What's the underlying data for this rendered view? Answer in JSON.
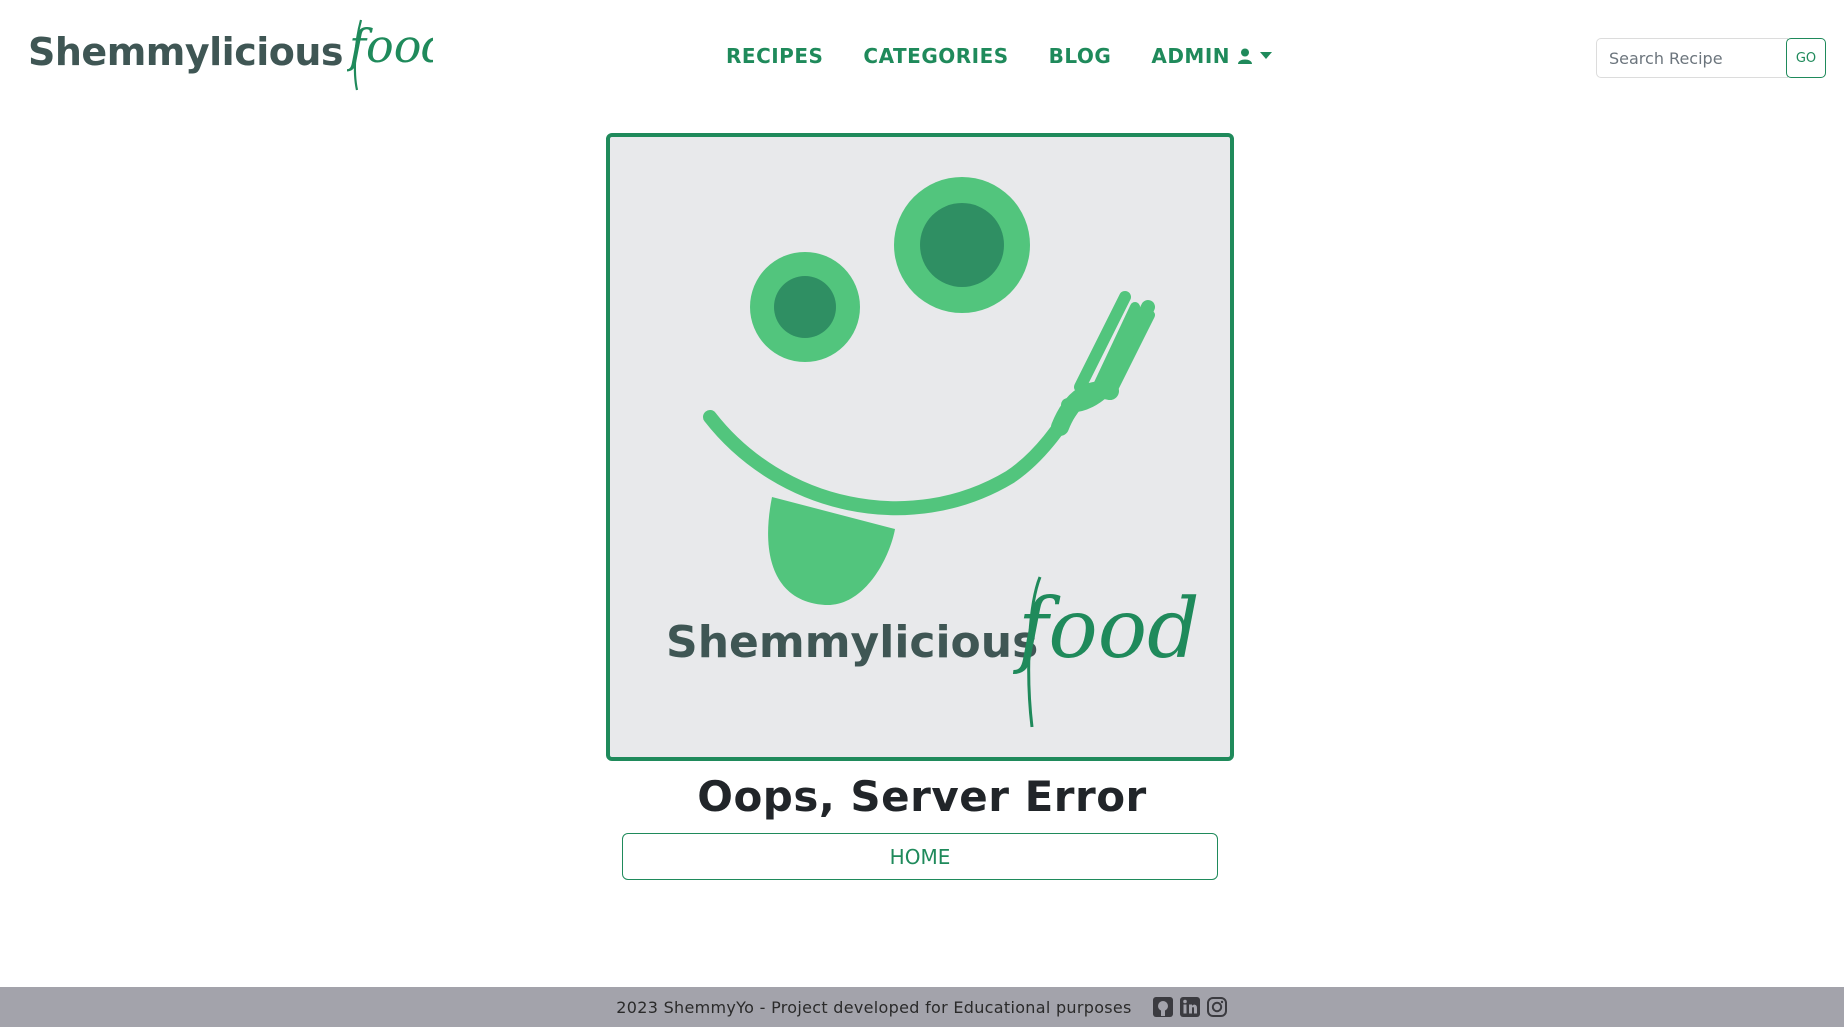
{
  "header": {
    "brand_word": "Shemmylicious",
    "brand_script": "food",
    "nav": {
      "recipes": "RECIPES",
      "categories": "CATEGORIES",
      "blog": "BLOG",
      "admin": "ADMIN"
    },
    "search": {
      "placeholder": "Search Recipe",
      "value": "",
      "button_label": "GO"
    }
  },
  "main": {
    "logo": {
      "word": "Shemmylicious",
      "script": "food"
    },
    "error_title": "Oops, Server Error",
    "home_button": "HOME"
  },
  "footer": {
    "text": "2023 ShemmyYo - Project developed for Educational purposes",
    "icons": [
      "github-icon",
      "linkedin-icon",
      "instagram-icon"
    ]
  },
  "colors": {
    "brand_green": "#1f8a5b",
    "logo_light_green": "#52c57d",
    "logo_dark_green": "#2f8f63",
    "brand_text": "#3f5654",
    "logo_background": "#e8e9eb",
    "footer_background": "#a3a3ab"
  }
}
